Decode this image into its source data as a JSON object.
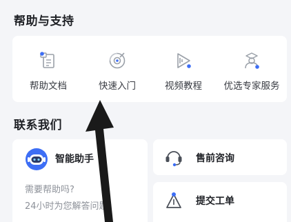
{
  "help_section": {
    "title": "帮助与支持",
    "items": [
      {
        "label": "帮助文档",
        "icon": "document-icon"
      },
      {
        "label": "快速入门",
        "icon": "quick-start-icon"
      },
      {
        "label": "视频教程",
        "icon": "video-play-icon"
      },
      {
        "label": "优选专家服务",
        "icon": "expert-icon"
      }
    ]
  },
  "contact_section": {
    "title": "联系我们",
    "assistant": {
      "title": "智能助手",
      "line1": "需要帮助吗?",
      "line2": "24小时为您解答问题",
      "icon": "robot-icon"
    },
    "presale": {
      "label": "售前咨询",
      "icon": "headset-icon"
    },
    "ticket": {
      "label": "提交工单",
      "icon": "ticket-icon"
    }
  },
  "colors": {
    "accent": "#3d6ef5",
    "icon_gray": "#9aa0a8",
    "background": "#f4f5f8",
    "arrow": "#1a1a1a"
  }
}
